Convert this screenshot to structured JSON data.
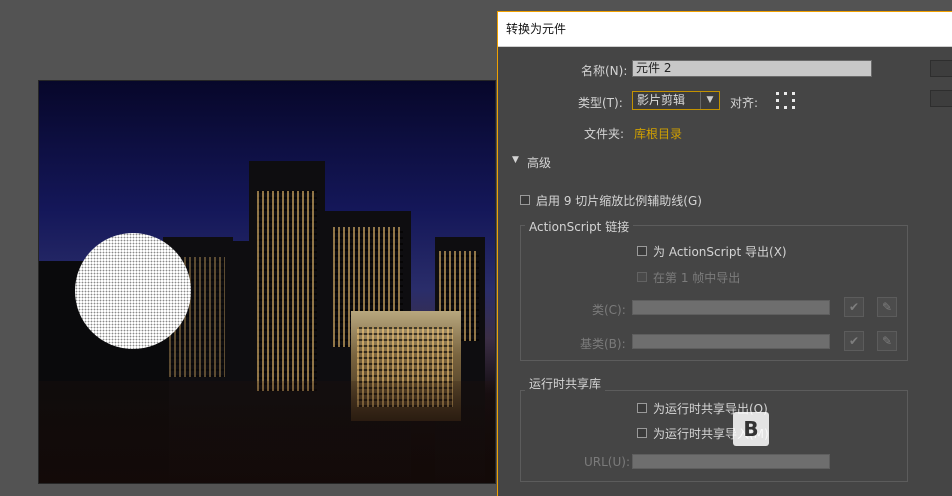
{
  "dialog": {
    "title": "转换为元件",
    "name_label": "名称(N):",
    "name_value": "元件 2",
    "type_label": "类型(T):",
    "type_value": "影片剪辑",
    "align_label": "对齐:",
    "folder_label": "文件夹:",
    "folder_value": "库根目录",
    "advanced_label": "高级",
    "enable_9slice_label": "启用 9 切片缩放比例辅助线(G)",
    "actionscript": {
      "group_title": "ActionScript 链接",
      "export_label": "为 ActionScript 导出(X)",
      "export_frame1_label": "在第 1 帧中导出",
      "class_label": "类(C):",
      "base_class_label": "基类(B):"
    },
    "runtime_sharing": {
      "group_title": "运行时共享库",
      "export_label": "为运行时共享导出(O)",
      "import_label": "为运行时共享导入(M)",
      "url_label": "URL(U):"
    }
  },
  "colors": {
    "highlight_box": "#e8141c",
    "accent": "#f0a000",
    "folder_link": "#d0a000"
  },
  "icons": [
    "triangle-down-icon",
    "align-grid-icon",
    "checkmark-icon",
    "pencil-icon",
    "dropdown-arrow-icon"
  ]
}
